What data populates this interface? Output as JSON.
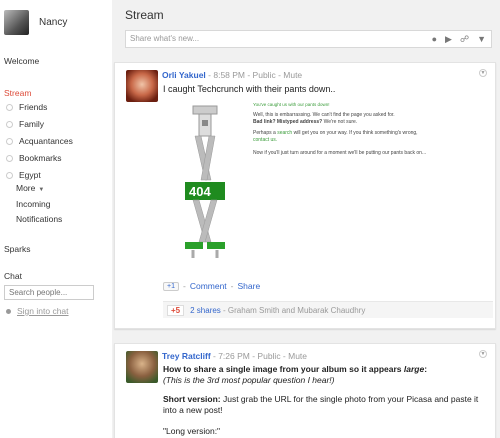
{
  "user": {
    "name": "Nancy"
  },
  "sidebar": {
    "welcome": "Welcome",
    "stream": "Stream",
    "circles": [
      "Friends",
      "Family",
      "Acquantances",
      "Bookmarks",
      "Egypt"
    ],
    "more": "More",
    "incoming": "Incoming",
    "notifications": "Notifications",
    "sparks": "Sparks",
    "chat": "Chat",
    "chat_placeholder": "Search people...",
    "sign_in_chat": "Sign into chat"
  },
  "main": {
    "title": "Stream",
    "share_placeholder": "Share what's new..."
  },
  "posts": [
    {
      "author": "Orli Yakuel",
      "meta": " - 8:58 PM - Public - Mute",
      "text": "I caught Techcrunch with their pants down..",
      "image": {
        "tagline": "You've caught us with our pants down!",
        "line1": "Well, this is embarrassing. We can't find the page you asked for.",
        "line2_bold": "Bad link? Mistyped address?",
        "line2_rest": " We're not sure.",
        "line3_pre": "Perhaps a ",
        "line3_link": "search",
        "line3_mid": " will get you on your way. If you think something's wrong, ",
        "line3_link2": "contact us.",
        "line4": "Now if you'll just turn around for a moment we'll be putting our pants back on...",
        "error_code": "404"
      },
      "plus_one_label": "+1",
      "comment": "Comment",
      "share": "Share",
      "plus_count": "+5",
      "shares": "2 shares",
      "sharers": " - Graham Smith and Mubarak Chaudhry"
    },
    {
      "author": "Trey Ratcliff",
      "meta": " - 7:26 PM - Public - Mute",
      "line1_pre": "How to share a single image from your album so it appears ",
      "line1_em": "large",
      "line1_post": ":",
      "line2": "(This is the 3rd most popular question I hear!)",
      "short_label": "Short version:",
      "short_text": " Just grab the URL for the single photo from your Picasa and paste it into a new post!",
      "long_label": "\"Long version:\""
    }
  ]
}
